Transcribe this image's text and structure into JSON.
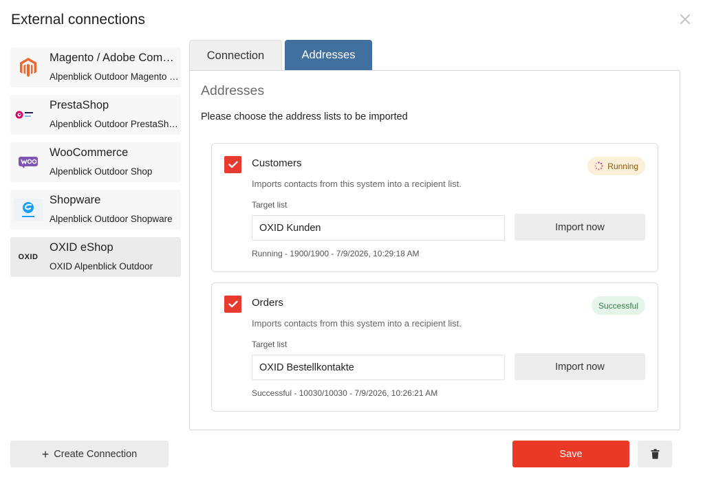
{
  "dialog": {
    "title": "External connections"
  },
  "connections": [
    {
      "name": "Magento / Adobe Commerce",
      "subtitle": "Alpenblick Outdoor Magento Store",
      "icon": "magento-logo-icon"
    },
    {
      "name": "PrestaShop",
      "subtitle": "Alpenblick Outdoor PrestaShop",
      "icon": "prestashop-logo-icon"
    },
    {
      "name": "WooCommerce",
      "subtitle": "Alpenblick Outdoor Shop",
      "icon": "woocommerce-logo-icon"
    },
    {
      "name": "Shopware",
      "subtitle": "Alpenblick Outdoor Shopware",
      "icon": "shopware-logo-icon"
    },
    {
      "name": "OXID eShop",
      "subtitle": "OXID Alpenblick Outdoor",
      "icon": "oxid-logo-icon",
      "logo_text": "OXID"
    }
  ],
  "tabs": {
    "connection": "Connection",
    "addresses": "Addresses"
  },
  "panel": {
    "title": "Addresses",
    "description": "Please choose the address lists to be imported"
  },
  "lists": [
    {
      "title": "Customers",
      "description": "Imports contacts from this system into a recipient list.",
      "target_label": "Target list",
      "target_value": "OXID Kunden",
      "import_label": "Import now",
      "status": "Running - 1900/1900 - 7/9/2026, 10:29:18 AM",
      "badge": "Running",
      "checked": true
    },
    {
      "title": "Orders",
      "description": "Imports contacts from this system into a recipient list.",
      "target_label": "Target list",
      "target_value": "OXID Bestellkontakte",
      "import_label": "Import now",
      "status": "Successful - 10030/10030 - 7/9/2026, 10:26:21 AM",
      "badge": "Successful",
      "checked": true
    }
  ],
  "footer": {
    "create_label": "Create Connection",
    "save_label": "Save"
  },
  "colors": {
    "accent_tab": "#41709f",
    "save": "#ea3a27",
    "checkbox": "#e63b2e",
    "running_bg": "#fcefd7",
    "success_bg": "#e6f5ea"
  }
}
